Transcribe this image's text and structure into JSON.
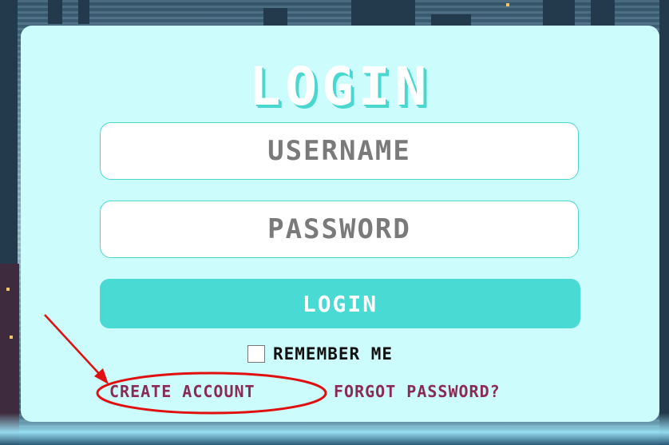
{
  "login_card": {
    "title": "LOGIN",
    "username": {
      "placeholder": "USERNAME"
    },
    "password": {
      "placeholder": "PASSWORD"
    },
    "login_button": "LOGIN",
    "remember_me": {
      "label": "REMEMBER ME",
      "checked": false
    },
    "links": {
      "create_account": "CREATE ACCOUNT",
      "forgot_password": "FORGOT PASSWORD?"
    }
  },
  "colors": {
    "card_bg": "#ccfcfb",
    "accent": "#49dbd3",
    "link": "#8a2a55",
    "annotation": "#e01010"
  },
  "annotation": {
    "icon": "red-arrow-icon",
    "highlight": "red-ellipse"
  }
}
